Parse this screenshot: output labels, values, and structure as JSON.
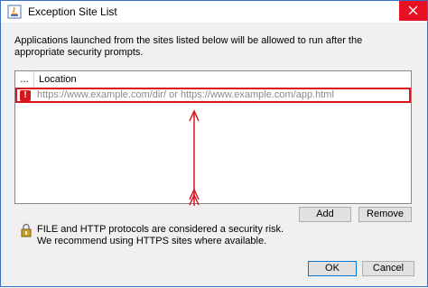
{
  "window": {
    "title": "Exception Site List",
    "close_icon": "close-icon",
    "app_icon": "java-icon"
  },
  "description": "Applications launched from the sites listed below will be allowed to run after the appropriate security prompts.",
  "table": {
    "columns": [
      "...",
      "Location"
    ],
    "rows": [
      {
        "status_icon": "error-icon",
        "status_glyph": "!",
        "location_placeholder": "https://www.example.com/dir/ or https://www.example.com/app.html"
      }
    ]
  },
  "buttons": {
    "add": "Add",
    "remove": "Remove",
    "ok": "OK",
    "cancel": "Cancel"
  },
  "warning": {
    "icon": "lock-warning-icon",
    "line1": "FILE and HTTP protocols are considered a security risk.",
    "line2": "We recommend using HTTPS sites where available."
  },
  "colors": {
    "accent": "#0078d7",
    "highlight": "#d7151b",
    "close": "#e81123"
  }
}
